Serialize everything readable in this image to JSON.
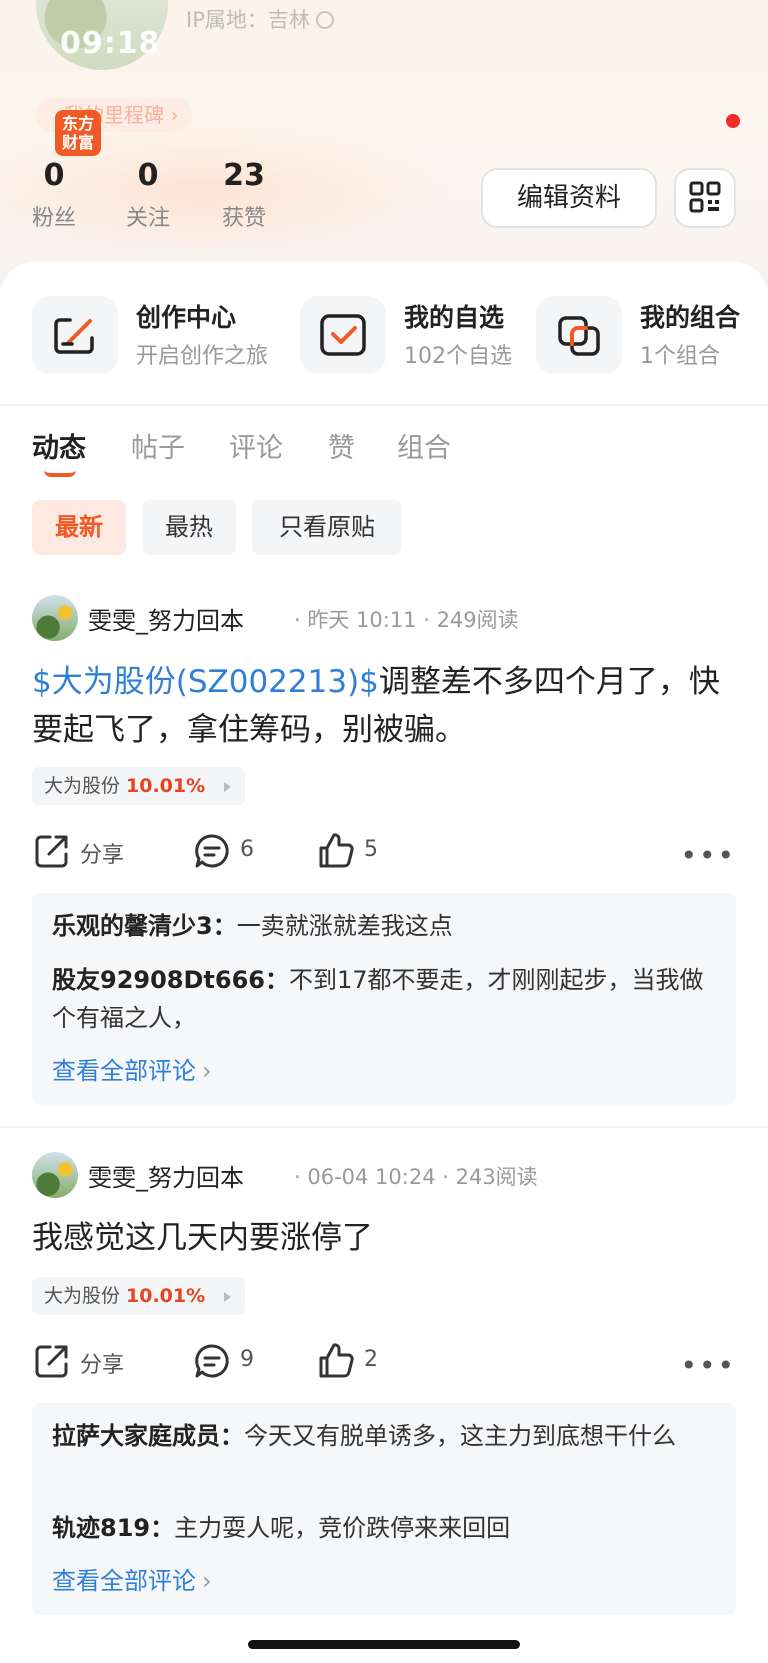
{
  "status_bar": {
    "time": "09:18"
  },
  "profile": {
    "ip_location": "IP属地：吉林",
    "milestone": "我的里程碑",
    "logo_text": "东方财富",
    "stats": [
      {
        "value": "0",
        "label": "粉丝"
      },
      {
        "value": "0",
        "label": "关注"
      },
      {
        "value": "23",
        "label": "获赞"
      }
    ],
    "edit_label": "编辑资料"
  },
  "quick_links": [
    {
      "title": "创作中心",
      "subtitle": "开启创作之旅",
      "icon": "pen-square-icon"
    },
    {
      "title": "我的自选",
      "subtitle": "102个自选",
      "icon": "check-square-icon"
    },
    {
      "title": "我的组合",
      "subtitle": "1个组合",
      "icon": "stacked-squares-icon"
    }
  ],
  "tabs": [
    "动态",
    "帖子",
    "评论",
    "赞",
    "组合"
  ],
  "active_tab": "动态",
  "filters": [
    "最新",
    "最热",
    "只看原贴"
  ],
  "active_filter": "最新",
  "posts": [
    {
      "author": "雯雯_努力回本",
      "meta": "· 昨天 10:11 · 249阅读",
      "stock_link": "$大为股份(SZ002213)$",
      "text": "调整差不多四个月了，快要起飞了，拿住筹码，别被骗。",
      "tag_name": "大为股份",
      "tag_pct": "10.01%",
      "share_label": "分享",
      "comment_count": "6",
      "like_count": "5",
      "comments": [
        {
          "user": "乐观的馨清少3：",
          "text": "一卖就涨就差我这点"
        },
        {
          "user": "股友92908Dt666：",
          "text": "不到17都不要走，才刚刚起步，当我做个有福之人，"
        }
      ],
      "view_all": "查看全部评论"
    },
    {
      "author": "雯雯_努力回本",
      "meta": "· 06-04 10:24 · 243阅读",
      "stock_link": "",
      "text": "我感觉这几天内要涨停了",
      "tag_name": "大为股份",
      "tag_pct": "10.01%",
      "share_label": "分享",
      "comment_count": "9",
      "like_count": "2",
      "comments": [
        {
          "user": "拉萨大家庭成员：",
          "text": "今天又有脱单诱多，这主力到底想干什么"
        },
        {
          "user": "轨迹819：",
          "text": "主力耍人呢，竞价跌停来来回回"
        }
      ],
      "view_all": "查看全部评论"
    }
  ],
  "colors": {
    "accent": "#f05a24",
    "link": "#2f7fd8",
    "gain": "#e8421f"
  }
}
